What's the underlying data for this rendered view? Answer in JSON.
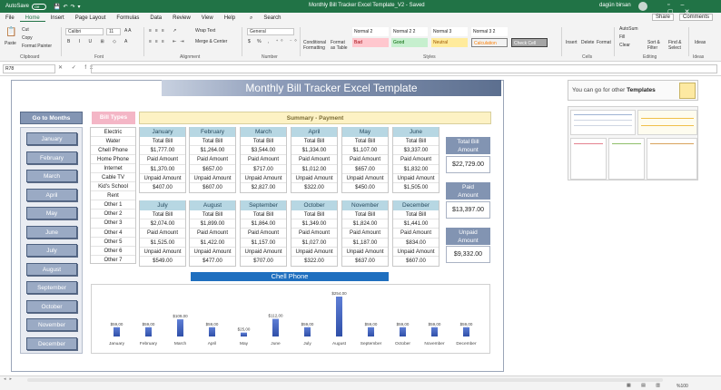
{
  "titlebar": {
    "autosave": "AutoSave",
    "autosave_state": "Off",
    "doc_title": "Monthly Bill Tracker Excel Template_V2  -  Saved",
    "user": "dagün birsan"
  },
  "menu": {
    "items": [
      "File",
      "Home",
      "Insert",
      "Page Layout",
      "Formulas",
      "Data",
      "Review",
      "View",
      "Help"
    ],
    "search": "Search",
    "share": "Share",
    "comments": "Comments"
  },
  "ribbon": {
    "clipboard": {
      "paste": "Paste",
      "cut": "Cut",
      "copy": "Copy",
      "format_painter": "Format Painter",
      "group": "Clipboard"
    },
    "font": {
      "name": "Calibri",
      "size": "11",
      "group": "Font"
    },
    "alignment": {
      "wrap": "Wrap Text",
      "merge": "Merge & Center",
      "group": "Alignment"
    },
    "number": {
      "format": "General",
      "group": "Number"
    },
    "styles": {
      "conditional": "Conditional Formatting",
      "format_table": "Format as Table",
      "normal2": "Normal 2",
      "normal22": "Normal 2 2",
      "normal3": "Normal 3",
      "normal32": "Normal 3 2",
      "bad": "Bad",
      "good": "Good",
      "neutral": "Neutral",
      "calculation": "Calculation",
      "check_cell": "Check Cell",
      "group": "Styles"
    },
    "cells": {
      "insert": "Insert",
      "delete": "Delete",
      "format": "Format",
      "group": "Cells"
    },
    "editing": {
      "autosum": "AutoSum",
      "fill": "Fill",
      "clear": "Clear",
      "sort": "Sort & Filter",
      "find": "Find & Select",
      "group": "Editing"
    },
    "ideas": {
      "label": "Ideas",
      "group": "Ideas"
    }
  },
  "formula_bar": {
    "name_box": "R78",
    "fx": "fx",
    "value": ""
  },
  "sheet": {
    "title": "Monthly Bill Tracker Excel Template",
    "goto_label": "Go to Months",
    "months_nav": [
      "January",
      "February",
      "March",
      "April",
      "May",
      "June",
      "July",
      "August",
      "September",
      "October",
      "November",
      "December"
    ],
    "bill_types_label": "Bill Types",
    "summary_label": "Summary - Payment",
    "bill_types": [
      "Electric",
      "Water",
      "Chell Phone",
      "Home Phone",
      "Internet",
      "Cable TV",
      "Kid's School",
      "Rent",
      "Other 1",
      "Other 2",
      "Other 3",
      "Other 4",
      "Other 5",
      "Other 6",
      "Other 7"
    ],
    "row_labels": [
      "Total Bill",
      "Total Bill",
      "Paid Amount",
      "Paid Amount",
      "Unpaid Amount",
      "Unpaid Amount"
    ],
    "months_top": [
      {
        "name": "January",
        "values": [
          "$1,777.00",
          "$1,370.00",
          "$407.00"
        ]
      },
      {
        "name": "February",
        "values": [
          "$1,264.00",
          "$657.00",
          "$607.00"
        ]
      },
      {
        "name": "March",
        "values": [
          "$3,544.00",
          "$717.00",
          "$2,827.00"
        ]
      },
      {
        "name": "April",
        "values": [
          "$1,334.00",
          "$1,012.00",
          "$322.00"
        ]
      },
      {
        "name": "May",
        "values": [
          "$1,107.00",
          "$657.00",
          "$450.00"
        ]
      },
      {
        "name": "June",
        "values": [
          "$3,337.00",
          "$1,832.00",
          "$1,505.00"
        ]
      }
    ],
    "months_bottom": [
      {
        "name": "July",
        "values": [
          "$2,074.00",
          "$1,525.00",
          "$549.00"
        ]
      },
      {
        "name": "August",
        "values": [
          "$1,899.00",
          "$1,422.00",
          "$477.00"
        ]
      },
      {
        "name": "September",
        "values": [
          "$1,864.00",
          "$1,157.00",
          "$707.00"
        ]
      },
      {
        "name": "October",
        "values": [
          "$1,349.00",
          "$1,027.00",
          "$322.00"
        ]
      },
      {
        "name": "November",
        "values": [
          "$1,824.00",
          "$1,187.00",
          "$637.00"
        ]
      },
      {
        "name": "December",
        "values": [
          "$1,441.00",
          "$834.00",
          "$607.00"
        ]
      }
    ],
    "totals": [
      {
        "label_1": "Total Bill",
        "label_2": "Amount",
        "value": "$22,729.00"
      },
      {
        "label_1": "Paid",
        "label_2": "Amount",
        "value": "$13,397.00"
      },
      {
        "label_1": "Unpaid",
        "label_2": "Amount",
        "value": "$9,332.00"
      }
    ],
    "ad_text_prefix": "You can go for other ",
    "ad_text_bold": "Templates"
  },
  "chart_data": {
    "type": "bar",
    "title": "Chell Phone",
    "categories": [
      "January",
      "February",
      "March",
      "April",
      "May",
      "June",
      "July",
      "August",
      "September",
      "October",
      "November",
      "December"
    ],
    "values": [
      59,
      59,
      109,
      59,
      25,
      112,
      59,
      254,
      59,
      59,
      59,
      59
    ],
    "labels": [
      "$59,00",
      "$59,00",
      "$109,00",
      "$59,00",
      "$25,00",
      "$112,00",
      "$59,00",
      "$254,00",
      "$59,00",
      "$59,00",
      "$59,00",
      "$59,00"
    ],
    "ylim": [
      0,
      254
    ],
    "colors": {
      "bar_top": "#5f7fd6",
      "bar_bottom": "#2f4fa8"
    }
  },
  "status": {
    "zoom": "%100"
  }
}
